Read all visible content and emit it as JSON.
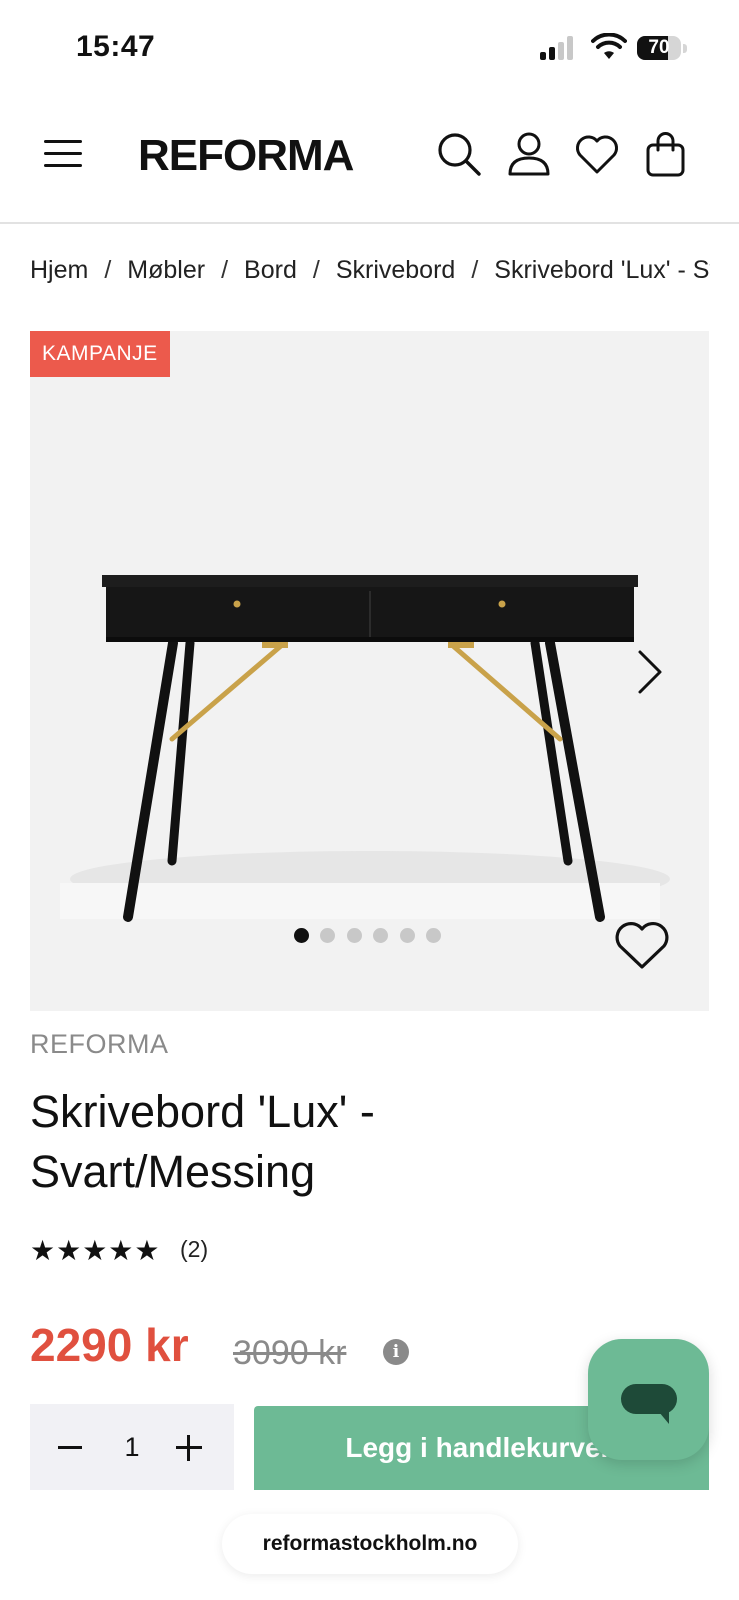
{
  "status_bar": {
    "time": "15:47",
    "battery": "70",
    "battery_level_percent": 70,
    "signal_bars_active": 2,
    "signal_bars_total": 4
  },
  "header": {
    "logo": "REFORMA",
    "icons": [
      "menu-icon",
      "search-icon",
      "account-icon",
      "wishlist-icon",
      "cart-icon"
    ]
  },
  "breadcrumb": {
    "items": [
      "Hjem",
      "Møbler",
      "Bord",
      "Skrivebord",
      "Skrivebord 'Lux' - Svart/Messing"
    ],
    "separator": "/"
  },
  "gallery": {
    "badge": "KAMPANJE",
    "image_count": 6,
    "active_index": 0,
    "colors": {
      "badge_bg": "#ec5a4c",
      "background": "#f2f2f2",
      "desk": "#1a1a1a",
      "brass": "#c9a24a"
    }
  },
  "product": {
    "brand": "REFORMA",
    "title_line1": "Skrivebord 'Lux' -",
    "title_line2": "Svart/Messing",
    "stars": "★★★★★",
    "rating": 5,
    "rating_count": "(2)",
    "price": "2290 kr",
    "old_price": "3090 kr",
    "info_glyph": "i"
  },
  "cart": {
    "quantity": "1",
    "add_label": "Legg i handlekurven"
  },
  "browser": {
    "url": "reformastockholm.no"
  },
  "colors": {
    "accent_green": "#6dba95",
    "sale_red": "#e0503f",
    "text": "#111111",
    "muted": "#8a8a8a"
  }
}
